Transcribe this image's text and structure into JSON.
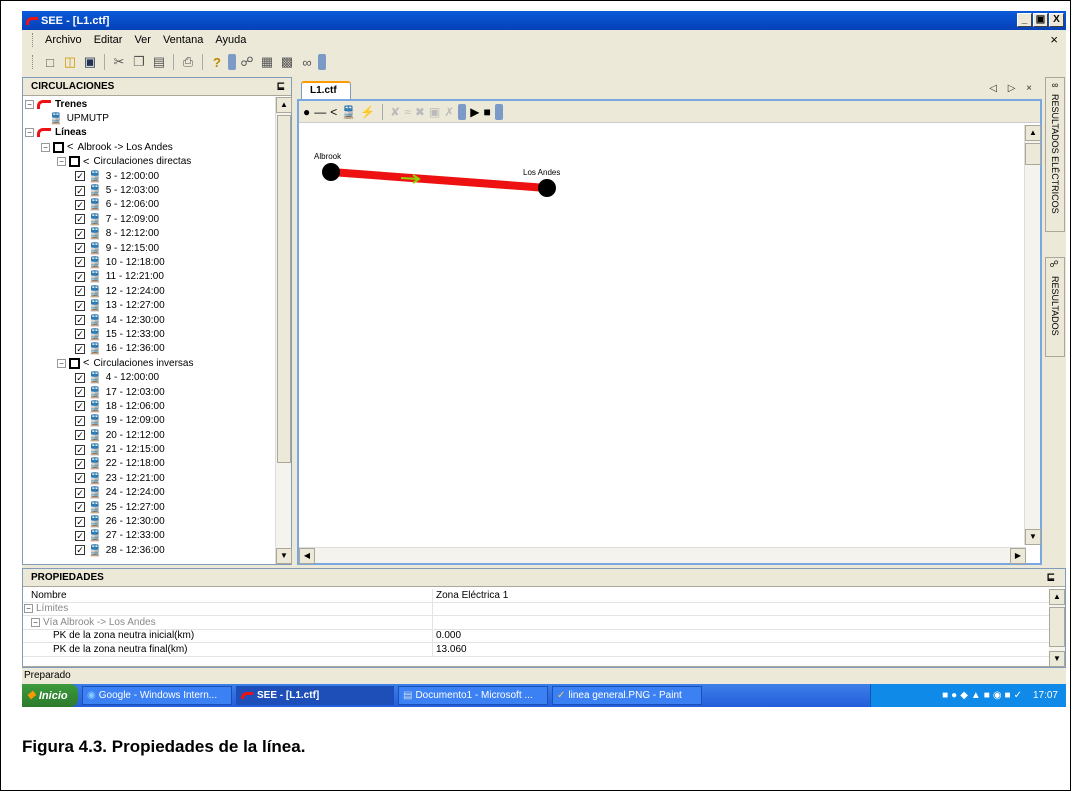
{
  "window": {
    "title": "SEE - [L1.ctf]",
    "min": "_",
    "max": "▣",
    "close": "X"
  },
  "menu": {
    "items": [
      "Archivo",
      "Editar",
      "Ver",
      "Ventana",
      "Ayuda"
    ],
    "close": "×"
  },
  "circulaciones": {
    "header": "CIRCULACIONES",
    "pin": "⊑",
    "trenes": "Trenes",
    "upmutp": "UPMUTP",
    "lineas": "Líneas",
    "route": "Albrook -> Los Andes",
    "directas": "Circulaciones directas",
    "directas_items": [
      "3 - 12:00:00",
      "5 - 12:03:00",
      "6 - 12:06:00",
      "7 - 12:09:00",
      "8 - 12:12:00",
      "9 - 12:15:00",
      "10 - 12:18:00",
      "11 - 12:21:00",
      "12 - 12:24:00",
      "13 - 12:27:00",
      "14 - 12:30:00",
      "15 - 12:33:00",
      "16 - 12:36:00"
    ],
    "inversas": "Circulaciones inversas",
    "inversas_items": [
      "4 - 12:00:00",
      "17 - 12:03:00",
      "18 - 12:06:00",
      "19 - 12:09:00",
      "20 - 12:12:00",
      "21 - 12:15:00",
      "22 - 12:18:00",
      "23 - 12:21:00",
      "24 - 12:24:00",
      "25 - 12:27:00",
      "26 - 12:30:00",
      "27 - 12:33:00",
      "28 - 12:36:00"
    ]
  },
  "document": {
    "tab": "L1.ctf",
    "tabnav": "◁ ▷ ×",
    "map": {
      "start_station": "Albrook",
      "end_station": "Los Andes",
      "line_color": "#ee1111",
      "station_color": "#000000",
      "arrow_color": "#8fd400"
    }
  },
  "side_tabs": {
    "electricos": "RESULTADOS ELÉCTRICOS",
    "resultados": "RESULTADOS"
  },
  "propiedades": {
    "header": "PROPIEDADES",
    "rows": [
      {
        "name": "Nombre",
        "value": "Zona Eléctrica 1"
      },
      {
        "name": "Límites",
        "value": ""
      },
      {
        "name": "Vía Albrook -> Los Andes",
        "value": ""
      },
      {
        "name": "PK de la zona neutra inicial(km)",
        "value": "0.000"
      },
      {
        "name": "PK de la zona neutra final(km)",
        "value": "13.060"
      }
    ]
  },
  "status": "Preparado",
  "taskbar": {
    "start": "Inicio",
    "tasks": [
      "Google - Windows Intern...",
      "SEE - [L1.ctf]",
      "Documento1 - Microsoft ...",
      "linea general.PNG - Paint"
    ],
    "clock": "17:07"
  },
  "caption": "Figura 4.3.  Propiedades de la línea."
}
